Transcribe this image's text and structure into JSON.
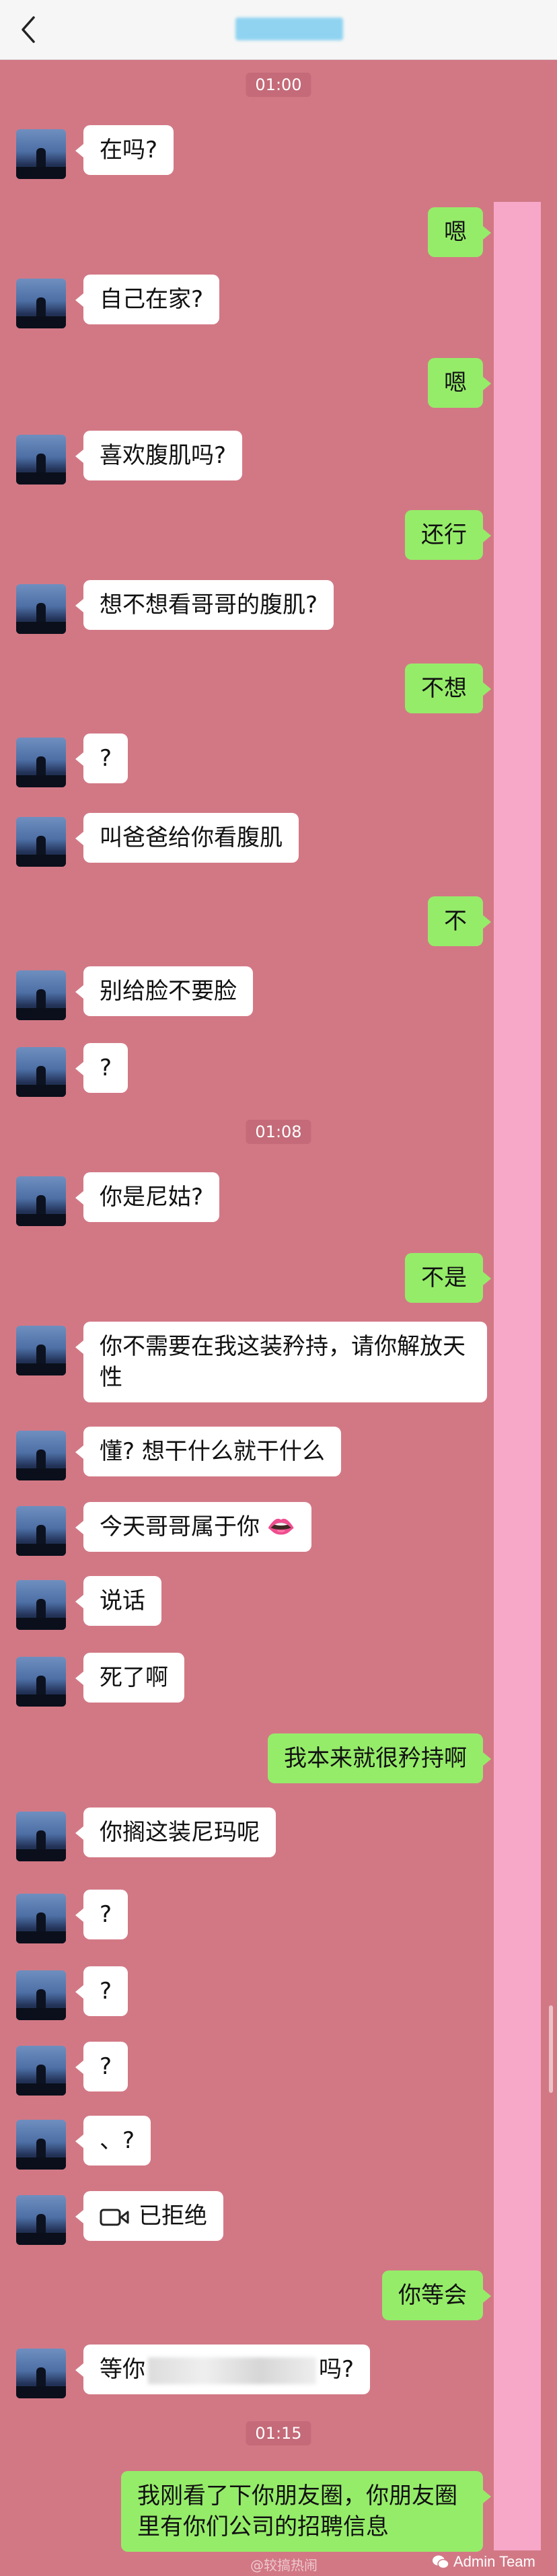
{
  "header": {
    "back_icon": "chevron-left-icon"
  },
  "timestamps": [
    "01:00",
    "01:08",
    "01:15"
  ],
  "messages": [
    {
      "side": "left",
      "text": "在吗?"
    },
    {
      "side": "right",
      "text": "嗯"
    },
    {
      "side": "left",
      "text": "自己在家?"
    },
    {
      "side": "right",
      "text": "嗯"
    },
    {
      "side": "left",
      "text": "喜欢腹肌吗?"
    },
    {
      "side": "right",
      "text": "还行"
    },
    {
      "side": "left",
      "text": "想不想看哥哥的腹肌?"
    },
    {
      "side": "right",
      "text": "不想"
    },
    {
      "side": "left",
      "text": "?"
    },
    {
      "side": "left",
      "text": "叫爸爸给你看腹肌"
    },
    {
      "side": "right",
      "text": "不"
    },
    {
      "side": "left",
      "text": "别给脸不要脸"
    },
    {
      "side": "left",
      "text": "?"
    },
    {
      "side": "left",
      "text": "你是尼姑?"
    },
    {
      "side": "right",
      "text": "不是"
    },
    {
      "side": "left",
      "text": "你不需要在我这装矜持，请你解放天性"
    },
    {
      "side": "left",
      "text": "懂? 想干什么就干什么"
    },
    {
      "side": "left",
      "text": "今天哥哥属于你",
      "emoji": "👄"
    },
    {
      "side": "left",
      "text": "说话"
    },
    {
      "side": "left",
      "text": "死了啊"
    },
    {
      "side": "right",
      "text": "我本来就很矜持啊"
    },
    {
      "side": "left",
      "text": "你搁这装尼玛呢"
    },
    {
      "side": "left",
      "text": "?"
    },
    {
      "side": "left",
      "text": "?"
    },
    {
      "side": "left",
      "text": "?"
    },
    {
      "side": "left",
      "text": "、?"
    },
    {
      "side": "left",
      "text": "已拒绝",
      "icon": "video-call-icon"
    },
    {
      "side": "right",
      "text": "你等会"
    },
    {
      "side": "left",
      "text_before": "等你",
      "text_after": "吗?"
    },
    {
      "side": "right",
      "text": "我刚看了下你朋友圈，你朋友圈里有你们公司的招聘信息"
    }
  ],
  "watermark": {
    "label": "Admin Team",
    "left_label": "@较搞热闹"
  },
  "colors": {
    "background": "#d27885",
    "bubble_left": "#ffffff",
    "bubble_right": "#95ec69",
    "mask": "#f7a8c8"
  }
}
